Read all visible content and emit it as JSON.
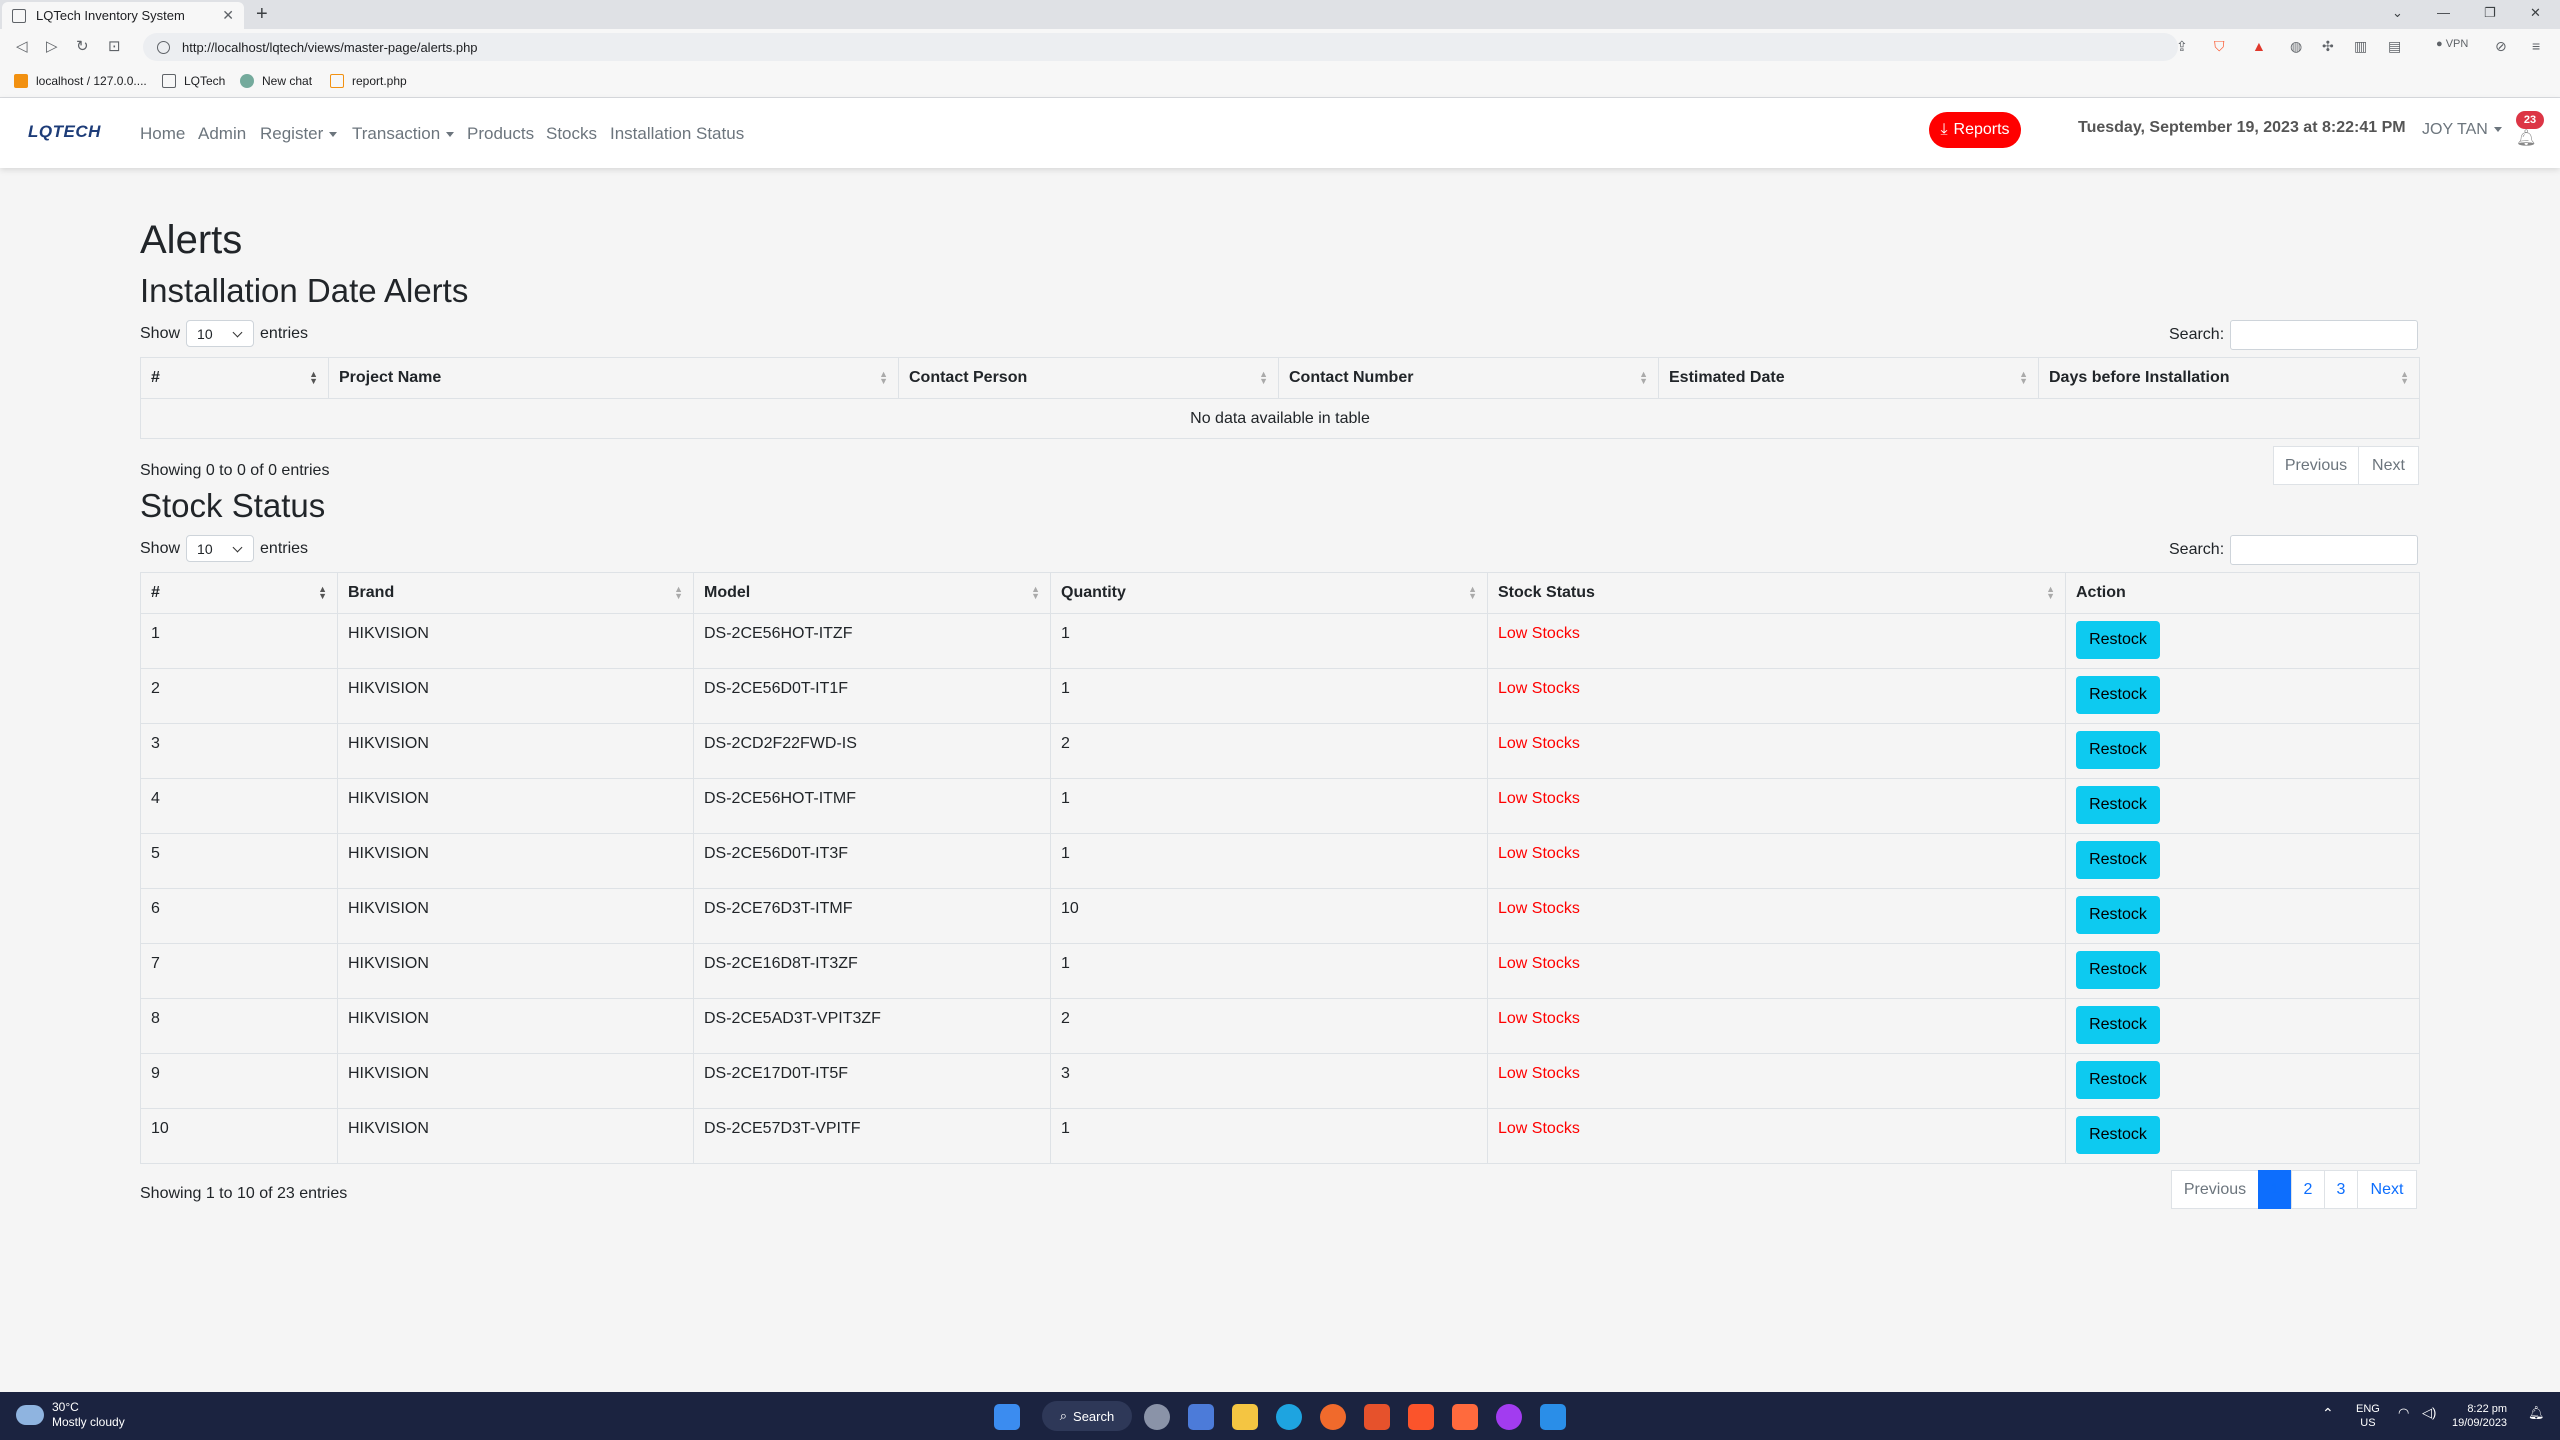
{
  "browser": {
    "tab_title": "LQTech Inventory System",
    "url": "http://localhost/lqtech/views/master-page/alerts.php",
    "bookmarks": [
      "localhost / 127.0.0....",
      "LQTech",
      "New chat",
      "report.php"
    ],
    "vpn_label": "VPN"
  },
  "navbar": {
    "brand": "LQTECH",
    "links": [
      "Home",
      "Admin",
      "Register",
      "Transaction",
      "Products",
      "Stocks",
      "Installation Status"
    ],
    "reports_label": "Reports",
    "datetime": "Tuesday, September 19, 2023 at 8:22:41 PM",
    "user": "JOY TAN",
    "notification_count": "23"
  },
  "page": {
    "title": "Alerts",
    "show_label": "Show",
    "entries_label": "entries",
    "search_label": "Search:",
    "page_length": "10"
  },
  "installation": {
    "title": "Installation Date Alerts",
    "columns": [
      "#",
      "Project Name",
      "Contact Person",
      "Contact Number",
      "Estimated Date",
      "Days before Installation"
    ],
    "empty_message": "No data available in table",
    "info": "Showing 0 to 0 of 0 entries",
    "prev": "Previous",
    "next": "Next"
  },
  "stock": {
    "title": "Stock Status",
    "columns": [
      "#",
      "Brand",
      "Model",
      "Quantity",
      "Stock Status",
      "Action"
    ],
    "rows": [
      {
        "n": "1",
        "brand": "HIKVISION",
        "model": "DS-2CE56HOT-ITZF",
        "qty": "1",
        "status": "Low Stocks"
      },
      {
        "n": "2",
        "brand": "HIKVISION",
        "model": "DS-2CE56D0T-IT1F",
        "qty": "1",
        "status": "Low Stocks"
      },
      {
        "n": "3",
        "brand": "HIKVISION",
        "model": "DS-2CD2F22FWD-IS",
        "qty": "2",
        "status": "Low Stocks"
      },
      {
        "n": "4",
        "brand": "HIKVISION",
        "model": "DS-2CE56HOT-ITMF",
        "qty": "1",
        "status": "Low Stocks"
      },
      {
        "n": "5",
        "brand": "HIKVISION",
        "model": "DS-2CE56D0T-IT3F",
        "qty": "1",
        "status": "Low Stocks"
      },
      {
        "n": "6",
        "brand": "HIKVISION",
        "model": "DS-2CE76D3T-ITMF",
        "qty": "10",
        "status": "Low Stocks"
      },
      {
        "n": "7",
        "brand": "HIKVISION",
        "model": "DS-2CE16D8T-IT3ZF",
        "qty": "1",
        "status": "Low Stocks"
      },
      {
        "n": "8",
        "brand": "HIKVISION",
        "model": "DS-2CE5AD3T-VPIT3ZF",
        "qty": "2",
        "status": "Low Stocks"
      },
      {
        "n": "9",
        "brand": "HIKVISION",
        "model": "DS-2CE17D0T-IT5F",
        "qty": "3",
        "status": "Low Stocks"
      },
      {
        "n": "10",
        "brand": "HIKVISION",
        "model": "DS-2CE57D3T-VPITF",
        "qty": "1",
        "status": "Low Stocks"
      }
    ],
    "action_label": "Restock",
    "info": "Showing 1 to 10 of 23 entries",
    "prev": "Previous",
    "pages": [
      "1",
      "2",
      "3"
    ],
    "active_page": "1",
    "next": "Next"
  },
  "taskbar": {
    "temperature": "30°C",
    "weather": "Mostly cloudy",
    "search": "Search",
    "lang": "ENG",
    "region": "US",
    "time": "8:22 pm",
    "date": "19/09/2023"
  },
  "colors": {
    "accent": "#0d6efd",
    "reports": "#ff0000",
    "low_stock": "#ff0000",
    "restock": "#0dcaf0",
    "brand": "#1d3c78"
  }
}
